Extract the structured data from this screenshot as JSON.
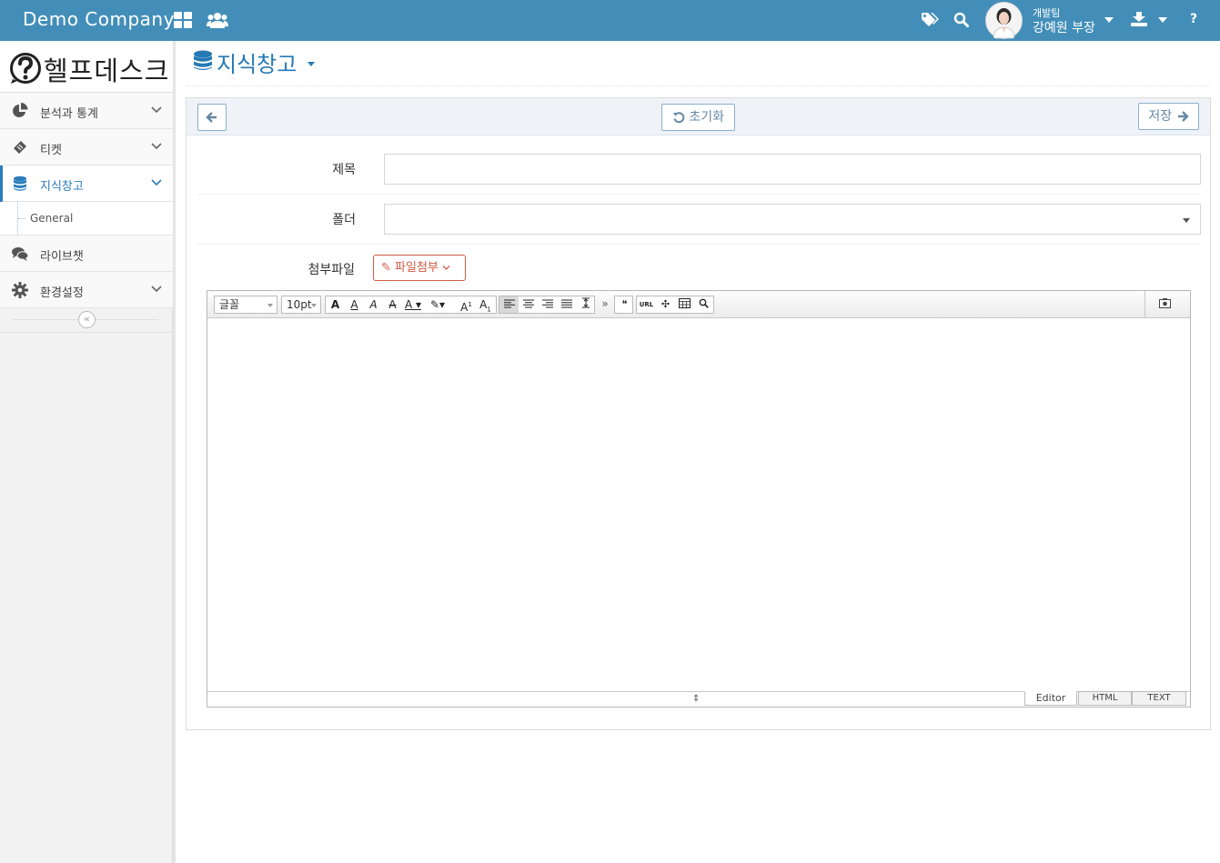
{
  "app": {
    "brand": "Demo Company",
    "user_team": "개발팀",
    "user_name": "강예원 부장",
    "help_label": "?"
  },
  "sidebar": {
    "logo_text": "헬프데스크",
    "items": [
      {
        "label": "분석과 통계",
        "icon": "pie-chart-icon"
      },
      {
        "label": "티켓",
        "icon": "ticket-icon"
      },
      {
        "label": "지식창고",
        "icon": "database-icon",
        "active": true
      },
      {
        "label": "라이브챗",
        "icon": "chat-icon"
      },
      {
        "label": "환경설정",
        "icon": "gear-icon"
      }
    ],
    "submenu": {
      "label": "General"
    }
  },
  "page": {
    "title": "지식창고"
  },
  "form": {
    "reset_label": "초기화",
    "save_label": "저장",
    "subject_label": "제목",
    "subject_value": "",
    "folder_label": "폴더",
    "folder_value": "",
    "attach_label": "첨부파일",
    "attach_button": "파일첨부"
  },
  "editor": {
    "font_select": "글꼴",
    "size_select": "10pt",
    "tabs": [
      "Editor",
      "HTML",
      "TEXT"
    ],
    "active_tab": "Editor",
    "url_label": "URL",
    "quote_glyph": "❝",
    "more_glyph": "»"
  },
  "colors": {
    "navbar": "#438eb9",
    "accent": "#2679b5",
    "attach": "#d15b47"
  }
}
